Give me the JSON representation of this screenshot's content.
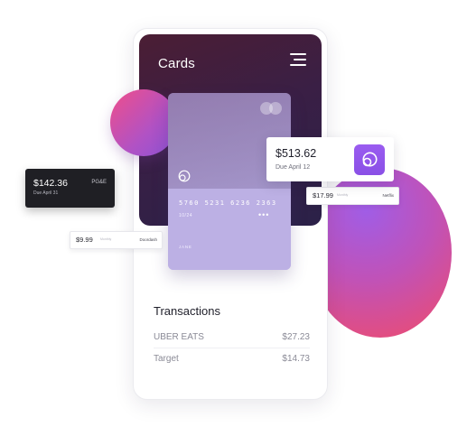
{
  "phone": {
    "title": "Cards",
    "card": {
      "number": "5760 5231 6236 2363",
      "expiry": "10/24",
      "dots": "•••",
      "holder": "JANE"
    },
    "transactions": {
      "title": "Transactions",
      "items": [
        {
          "merchant": "UBER EATS",
          "amount": "$27.23"
        },
        {
          "merchant": "Target",
          "amount": "$14.73"
        }
      ]
    }
  },
  "widgets": {
    "pge": {
      "amount": "$142.36",
      "due": "Due April 31",
      "vendor": "PG&E"
    },
    "doordash": {
      "amount": "$9.99",
      "freq": "Monthly",
      "vendor": "Doordash"
    },
    "netflix": {
      "amount": "$17.99",
      "freq": "Monthly",
      "vendor": "Netflix"
    },
    "featured": {
      "amount": "$513.62",
      "due": "Due April 12"
    }
  },
  "icons": [
    "hamburger-menu-icon",
    "card-brand-logo-icon",
    "card-chip-icon",
    "app-logo-icon"
  ],
  "colors": {
    "accent_purple": "#9a5cf0",
    "header_dark": "#3a1f45",
    "card_lavender": "#bcb0e4",
    "orb_pink": "#f04b6a"
  }
}
